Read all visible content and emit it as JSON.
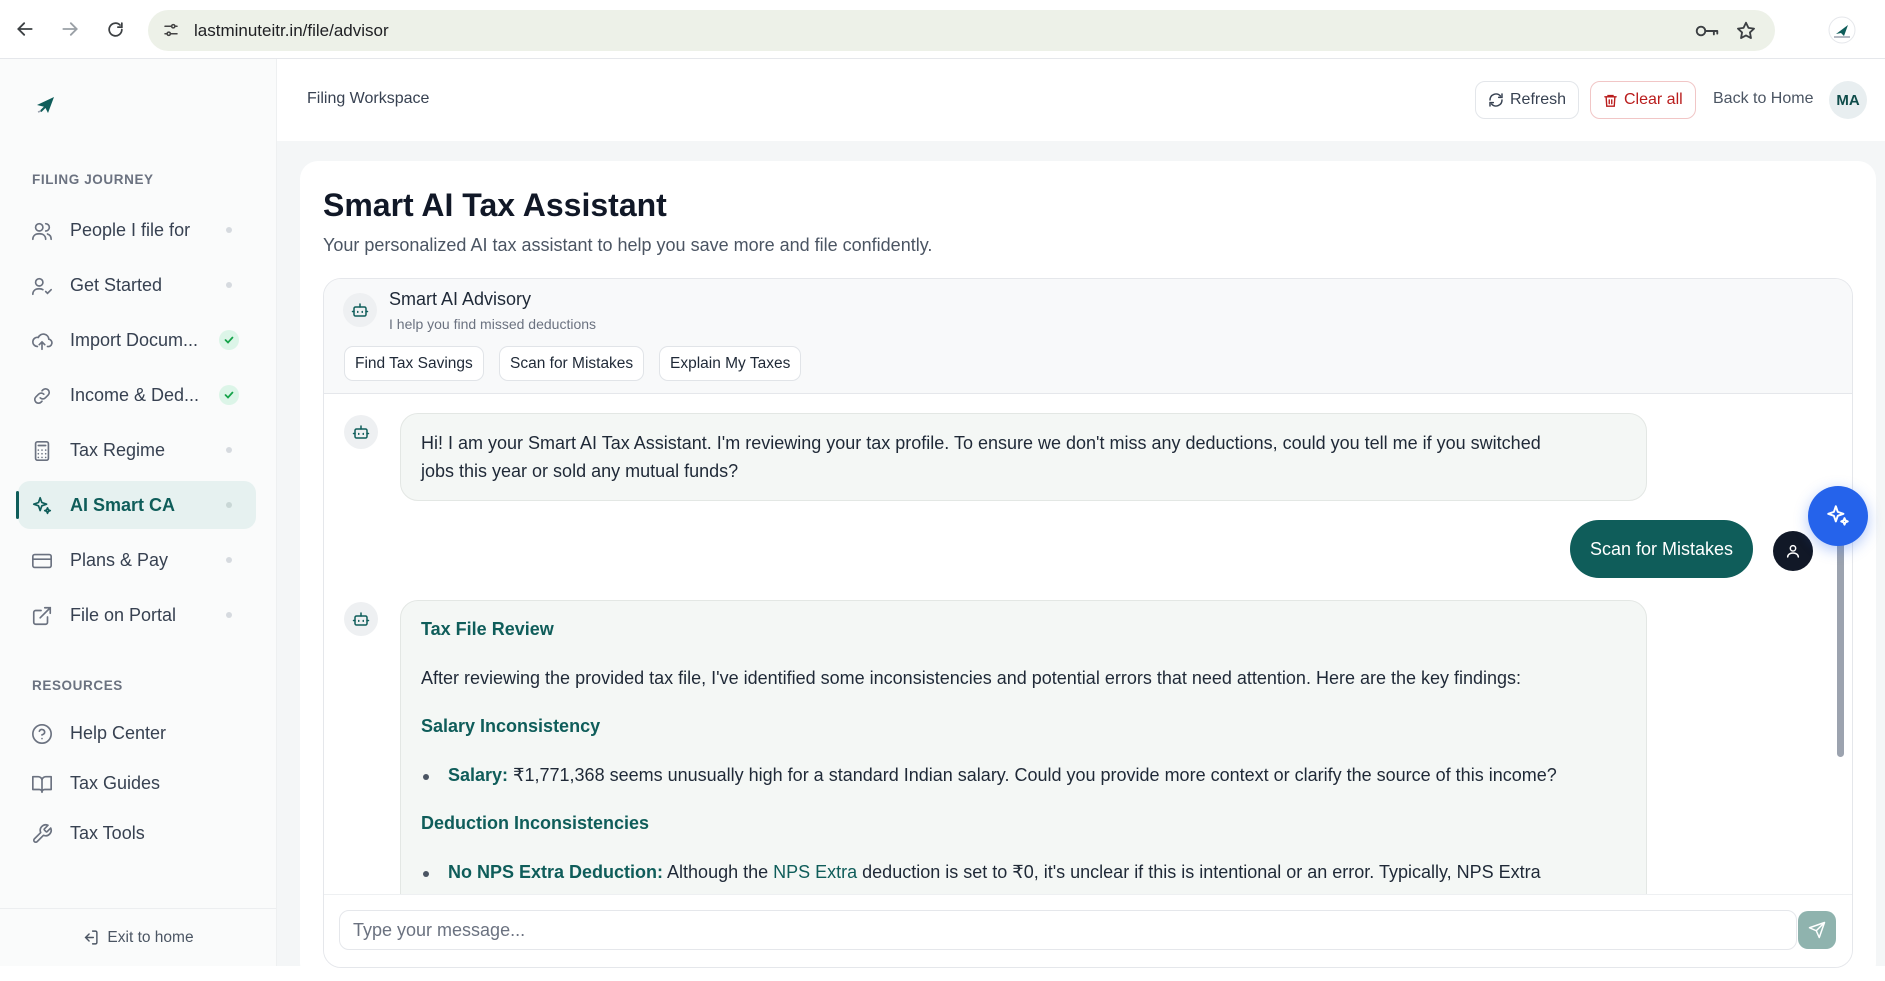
{
  "browser": {
    "url": "lastminuteitr.in/file/advisor"
  },
  "sidebar": {
    "journey_label": "FILING JOURNEY",
    "items": [
      {
        "label": "People I file for",
        "state": "pending"
      },
      {
        "label": "Get Started",
        "state": "pending"
      },
      {
        "label": "Import Docum...",
        "state": "done"
      },
      {
        "label": "Income & Ded...",
        "state": "done"
      },
      {
        "label": "Tax Regime",
        "state": "pending"
      },
      {
        "label": "AI Smart CA",
        "state": "active"
      },
      {
        "label": "Plans & Pay",
        "state": "pending"
      },
      {
        "label": "File on Portal",
        "state": "pending"
      }
    ],
    "resources_label": "RESOURCES",
    "resources": [
      {
        "label": "Help Center"
      },
      {
        "label": "Tax Guides"
      },
      {
        "label": "Tax Tools"
      }
    ],
    "footer": "Exit to home"
  },
  "header": {
    "crumb": "Filing Workspace",
    "refresh": "Refresh",
    "clear": "Clear all",
    "back": "Back to Home",
    "avatar": "MA"
  },
  "page": {
    "title": "Smart AI Tax Assistant",
    "subtitle": "Your personalized AI tax assistant to help you save more and file confidently."
  },
  "chat": {
    "title": "Smart AI Advisory",
    "subtitle": "I help you find missed deductions",
    "chips": [
      "Find Tax Savings",
      "Scan for Mistakes",
      "Explain My Taxes"
    ],
    "msg1_line1": "Hi! I am your Smart AI Tax Assistant. I'm reviewing your tax profile. To ensure we don't miss any deductions, could you tell me if you switched",
    "msg1_line2": "jobs this year or sold any mutual funds?",
    "user_msg": "Scan for Mistakes",
    "review": {
      "heading": "Tax File Review",
      "intro": "After reviewing the provided tax file, I've identified some inconsistencies and potential errors that need attention. Here are the key findings:",
      "h_salary": "Salary Inconsistency",
      "salary_key": "Salary:",
      "salary_text": " ₹1,771,368 seems unusually high for a standard Indian salary. Could you provide more context or clarify the source of this income?",
      "h_deduction": "Deduction Inconsistencies",
      "nps_key": "No NPS Extra Deduction:",
      "nps_text1": " Although the ",
      "nps_term": "NPS Extra",
      "nps_text2": " deduction is set to ₹0, it's unclear if this is intentional or an error. Typically, NPS Extra"
    },
    "placeholder": "Type your message..."
  },
  "colors": {
    "brand": "#0f5d5a",
    "fab": "#2563eb",
    "danger": "#b91c1c"
  },
  "icons": [
    "back-arrow-icon",
    "forward-arrow-icon",
    "reload-icon",
    "site-settings-icon",
    "key-icon",
    "star-icon",
    "profile-icon",
    "logo-icon",
    "people-icon",
    "user-check-icon",
    "cloud-upload-icon",
    "link-icon",
    "calculator-icon",
    "sparkles-icon",
    "credit-card-icon",
    "external-link-icon",
    "help-circle-icon",
    "book-icon",
    "wrench-icon",
    "exit-icon",
    "refresh-icon",
    "trash-icon",
    "bot-icon",
    "user-icon",
    "send-icon"
  ]
}
